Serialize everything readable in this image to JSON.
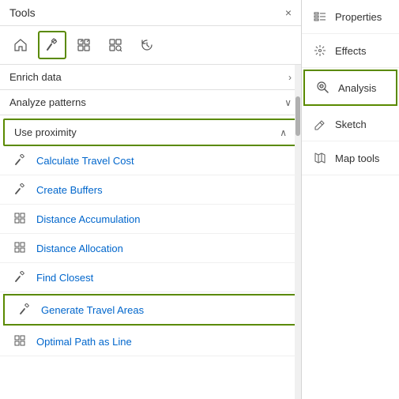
{
  "tools_panel": {
    "title": "Tools",
    "close_label": "×"
  },
  "toolbar": {
    "icons": [
      {
        "name": "home-icon",
        "label": "Home"
      },
      {
        "name": "hammer-icon",
        "label": "Hammer (active)"
      },
      {
        "name": "grid-analyze-icon",
        "label": "Analyze"
      },
      {
        "name": "grid-find-icon",
        "label": "Find"
      },
      {
        "name": "history-icon",
        "label": "History"
      }
    ]
  },
  "sections": [
    {
      "id": "enrich-data",
      "label": "Enrich data",
      "collapsed": true,
      "arrow": "›"
    },
    {
      "id": "analyze-patterns",
      "label": "Analyze patterns",
      "collapsed": true,
      "arrow": "∨"
    },
    {
      "id": "use-proximity",
      "label": "Use proximity",
      "highlighted": true,
      "arrow": "∧",
      "tools": [
        {
          "id": "calc-travel-cost",
          "label": "Calculate Travel Cost",
          "icon": "hammer"
        },
        {
          "id": "create-buffers",
          "label": "Create Buffers",
          "icon": "hammer"
        },
        {
          "id": "distance-accumulation",
          "label": "Distance Accumulation",
          "icon": "grid"
        },
        {
          "id": "distance-allocation",
          "label": "Distance Allocation",
          "icon": "grid"
        },
        {
          "id": "find-closest",
          "label": "Find Closest",
          "icon": "hammer"
        },
        {
          "id": "generate-travel-areas",
          "label": "Generate Travel Areas",
          "icon": "hammer",
          "highlighted": true
        },
        {
          "id": "optimal-path-as-line",
          "label": "Optimal Path as Line",
          "icon": "grid"
        }
      ]
    }
  ],
  "right_panel": {
    "items": [
      {
        "id": "properties",
        "label": "Properties",
        "icon": "properties-icon"
      },
      {
        "id": "effects",
        "label": "Effects",
        "icon": "effects-icon"
      },
      {
        "id": "analysis",
        "label": "Analysis",
        "icon": "analysis-icon",
        "active": true
      },
      {
        "id": "sketch",
        "label": "Sketch",
        "icon": "sketch-icon"
      },
      {
        "id": "map-tools",
        "label": "Map tools",
        "icon": "map-tools-icon"
      }
    ]
  }
}
